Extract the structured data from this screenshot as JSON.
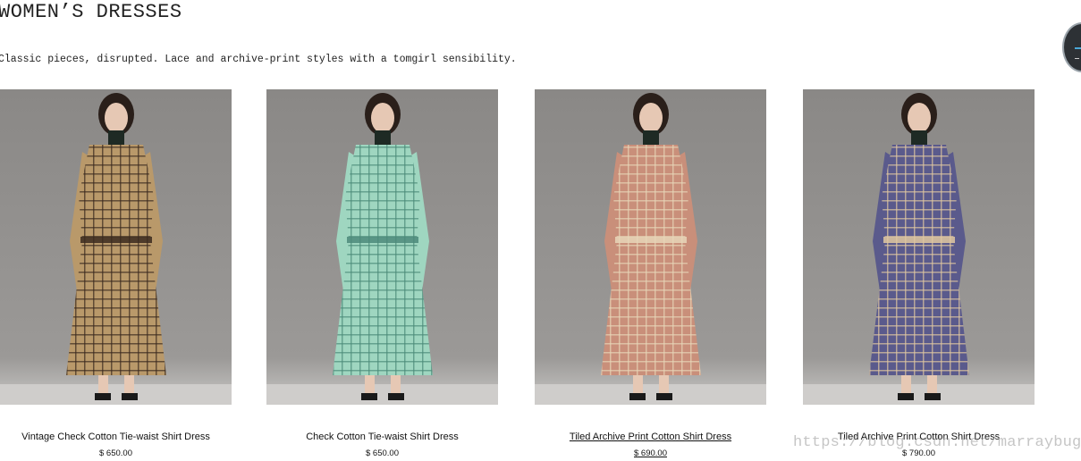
{
  "header": {
    "title": "WOMEN’S DRESSES",
    "subtitle": "Classic pieces, disrupted. Lace and archive-print styles with a tomgirl sensibility."
  },
  "products": [
    {
      "name": "Vintage Check Cotton Tie-waist Shirt Dress",
      "price": "$ 650.00",
      "dress_color": "#b9996a",
      "accent_color": "#3b2a1e",
      "underlined": false
    },
    {
      "name": "Check Cotton Tie-waist Shirt Dress",
      "price": "$ 650.00",
      "dress_color": "#9fd6c0",
      "accent_color": "#4c8a7a",
      "underlined": false
    },
    {
      "name": "Tiled Archive Print Cotton Shirt Dress",
      "price": "$ 690.00",
      "dress_color": "#c98f7a",
      "accent_color": "#e8d6b8",
      "underlined": true
    },
    {
      "name": "Tiled Archive Print Cotton Shirt Dress",
      "price": "$ 790.00",
      "dress_color": "#5a5a8c",
      "accent_color": "#e0c8a0",
      "underlined": false
    }
  ],
  "watermark": "https://blog.csdn.net/marraybug",
  "widget": {
    "icon": "floating-widget-icon"
  }
}
